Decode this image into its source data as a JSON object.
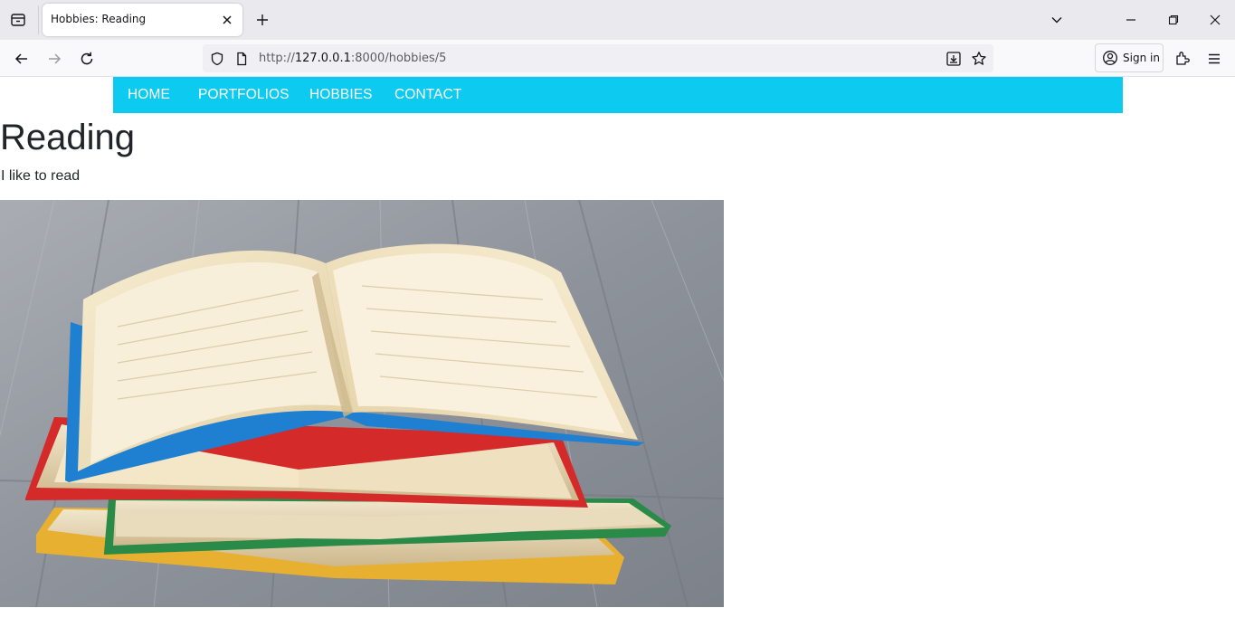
{
  "browser": {
    "tab_title": "Hobbies: Reading",
    "url_prefix": "http://",
    "url_host": "127.0.0.1",
    "url_rest": ":8000/hobbies/5",
    "signin_label": "Sign in"
  },
  "nav": {
    "items": [
      {
        "label": "HOME"
      },
      {
        "label": "PORTFOLIOS"
      },
      {
        "label": "HOBBIES"
      },
      {
        "label": "CONTACT"
      }
    ],
    "color": "#0dcaf0"
  },
  "hobby": {
    "title": "Reading",
    "description": "I like to read",
    "image_icon": "stack-of-open-books-photo"
  },
  "colors": {
    "book_blue": "#1f7fd0",
    "book_red": "#d42a2a",
    "book_green": "#2a8a48",
    "book_yellow": "#e8b030",
    "wood": "#8a8f98"
  }
}
